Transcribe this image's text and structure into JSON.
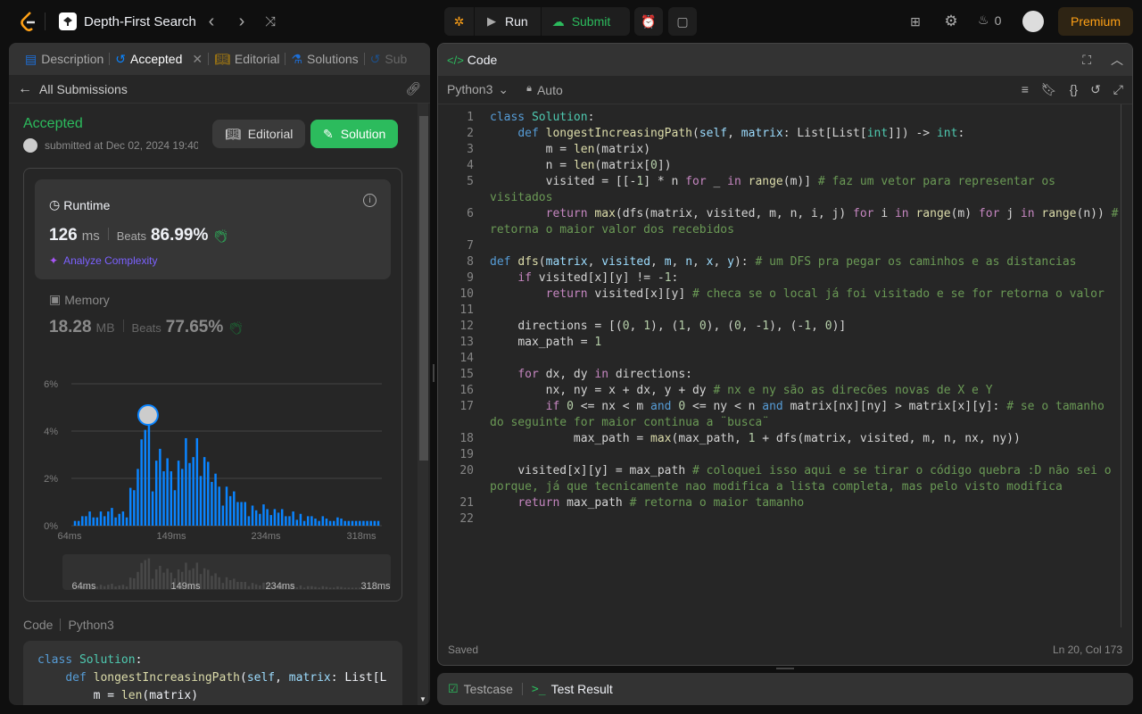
{
  "topbar": {
    "problem_title": "Depth-First Search",
    "run_label": "Run",
    "submit_label": "Submit",
    "streak_count": "0",
    "premium_label": "Premium"
  },
  "left": {
    "tabs": [
      {
        "label": "Description"
      },
      {
        "label": "Accepted"
      },
      {
        "label": "Editorial"
      },
      {
        "label": "Solutions"
      },
      {
        "label": "Sub"
      }
    ],
    "back_label": "All Submissions",
    "status": "Accepted",
    "submitted": "submitted at Dec 02, 2024 19:40",
    "editorial_button": "Editorial",
    "solution_button": "Solution",
    "runtime": {
      "title": "Runtime",
      "value": "126",
      "unit": "ms",
      "beats_label": "Beats",
      "beats": "86.99%",
      "analyze": "Analyze Complexity"
    },
    "memory": {
      "title": "Memory",
      "value": "18.28",
      "unit": "MB",
      "beats_label": "Beats",
      "beats": "77.65%"
    },
    "code_label": "Code",
    "code_lang": "Python3",
    "code_preview": [
      "class Solution:",
      "    def longestIncreasingPath(self, matrix: List[L",
      "        m = len(matrix)"
    ]
  },
  "chart_data": {
    "type": "bar",
    "ylabel": "",
    "xlabel": "",
    "yticks": [
      "6%",
      "4%",
      "2%",
      "0%"
    ],
    "ylim": [
      0,
      6
    ],
    "xticks": [
      "64ms",
      "149ms",
      "234ms",
      "318ms"
    ],
    "user_bar_index": 20,
    "color": "#0a84ff",
    "values": [
      0.2,
      0.2,
      0.4,
      0.4,
      0.6,
      0.35,
      0.35,
      0.6,
      0.4,
      0.6,
      0.75,
      0.35,
      0.5,
      0.6,
      0.35,
      1.6,
      1.5,
      2.4,
      3.65,
      4.05,
      4.3,
      1.45,
      2.75,
      3.25,
      2.3,
      2.85,
      2.3,
      1.5,
      2.75,
      2.4,
      3.7,
      2.65,
      2.9,
      3.7,
      2.1,
      2.9,
      2.7,
      1.85,
      2.2,
      1.65,
      0.85,
      1.65,
      1.25,
      1.45,
      1.0,
      1.0,
      1.0,
      0.4,
      0.85,
      0.65,
      0.5,
      0.9,
      0.7,
      0.45,
      0.7,
      0.55,
      0.7,
      0.4,
      0.4,
      0.6,
      0.25,
      0.5,
      0.2,
      0.4,
      0.4,
      0.3,
      0.2,
      0.4,
      0.3,
      0.2,
      0.2,
      0.35,
      0.3,
      0.2,
      0.2,
      0.2,
      0.2,
      0.2,
      0.2,
      0.2,
      0.2,
      0.2,
      0.2
    ]
  },
  "editor": {
    "title": "Code",
    "language": "Python3",
    "mode": "Auto",
    "status": "Saved",
    "cursor": "Ln 20, Col 173",
    "lines": [
      "class Solution:",
      "    def longestIncreasingPath(self, matrix: List[List[int]]) -> int:",
      "        m = len(matrix)",
      "        n = len(matrix[0])",
      "        visited = [[-1] * n for _ in range(m)] # faz um vetor para representar os visitados",
      "        return max(dfs(matrix, visited, m, n, i, j) for i in range(m) for j in range(n)) # retorna o maior valor dos recebidos",
      "",
      "def dfs(matrix, visited, m, n, x, y): # um DFS pra pegar os caminhos e as distancias",
      "    if visited[x][y] != -1:",
      "        return visited[x][y] # checa se o local já foi visitado e se for retorna o valor",
      "",
      "    directions = [(0, 1), (1, 0), (0, -1), (-1, 0)]",
      "    max_path = 1",
      "",
      "    for dx, dy in directions:",
      "        nx, ny = x + dx, y + dy # nx e ny são as direcões novas de X e Y",
      "        if 0 <= nx < m and 0 <= ny < n and matrix[nx][ny] > matrix[x][y]: # se o tamanho do seguinte for maior continua a ¨busca¨",
      "            max_path = max(max_path, 1 + dfs(matrix, visited, m, n, nx, ny))",
      "",
      "    visited[x][y] = max_path # coloquei isso aqui e se tirar o código quebra :D não sei o porque, já que tecnicamente nao modifica a lista completa, mas pelo visto modifica",
      "    return max_path # retorna o maior tamanho",
      ""
    ]
  },
  "bottom": {
    "testcase_label": "Testcase",
    "result_label": "Test Result"
  }
}
